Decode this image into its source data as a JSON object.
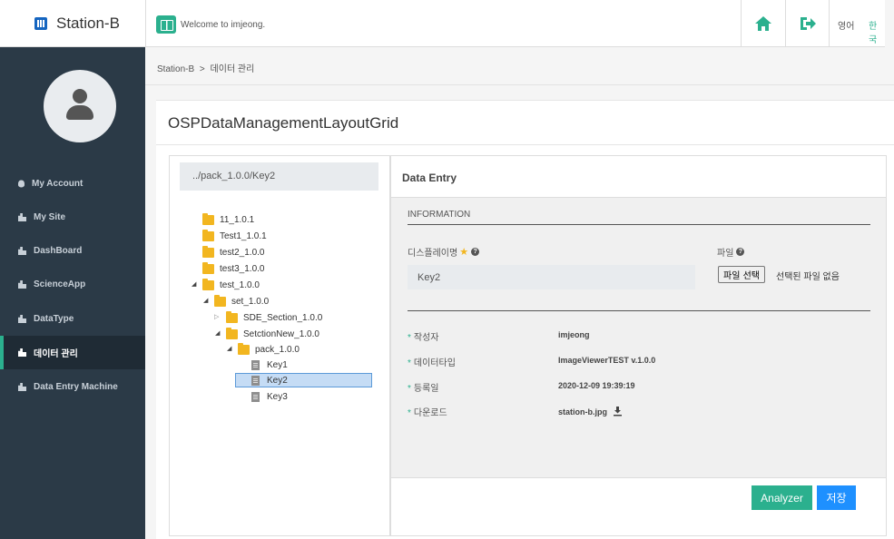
{
  "brand": {
    "title": "Station-B"
  },
  "topbar": {
    "welcome": "Welcome to imjeong.",
    "lang_en": "영어",
    "lang_ko": "한국"
  },
  "sidebar": {
    "items": [
      {
        "label": "My Account"
      },
      {
        "label": "My Site"
      },
      {
        "label": "DashBoard"
      },
      {
        "label": "ScienceApp"
      },
      {
        "label": "DataType"
      },
      {
        "label": "데이터 관리"
      },
      {
        "label": "Data Entry Machine"
      }
    ]
  },
  "breadcrumb": {
    "home": "Station-B",
    "sep": ">",
    "current": "데이터 관리"
  },
  "panel": {
    "title": "OSPDataManagementLayoutGrid"
  },
  "tree": {
    "path": "../pack_1.0.0/Key2",
    "nodes": [
      {
        "label": "11_1.0.1"
      },
      {
        "label": "Test1_1.0.1"
      },
      {
        "label": "test2_1.0.0"
      },
      {
        "label": "test3_1.0.0"
      },
      {
        "label": "test_1.0.0"
      },
      {
        "label": "set_1.0.0"
      },
      {
        "label": "SDE_Section_1.0.0"
      },
      {
        "label": "SetctionNew_1.0.0"
      },
      {
        "label": "pack_1.0.0"
      },
      {
        "label": "Key1"
      },
      {
        "label": "Key2"
      },
      {
        "label": "Key3"
      }
    ]
  },
  "entry": {
    "header": "Data Entry",
    "info_label": "INFORMATION",
    "display_name_label": "디스플레이명",
    "display_name_value": "Key2",
    "file_label": "파일",
    "file_button": "파일 선택",
    "file_none": "선택된 파일 없음",
    "meta": [
      {
        "key": "작성자",
        "value": "imjeong"
      },
      {
        "key": "데이터타입",
        "value": "ImageViewerTEST v.1.0.0"
      },
      {
        "key": "등록일",
        "value": "2020-12-09 19:39:19"
      },
      {
        "key": "다운로드",
        "value": "station-b.jpg"
      }
    ],
    "analyzer_button": "Analyzer",
    "save_button": "저장"
  },
  "colors": {
    "accent": "#2bb08e",
    "sidebar_bg": "#2b3a47",
    "save_blue": "#1e90ff",
    "folder": "#f2b620"
  }
}
